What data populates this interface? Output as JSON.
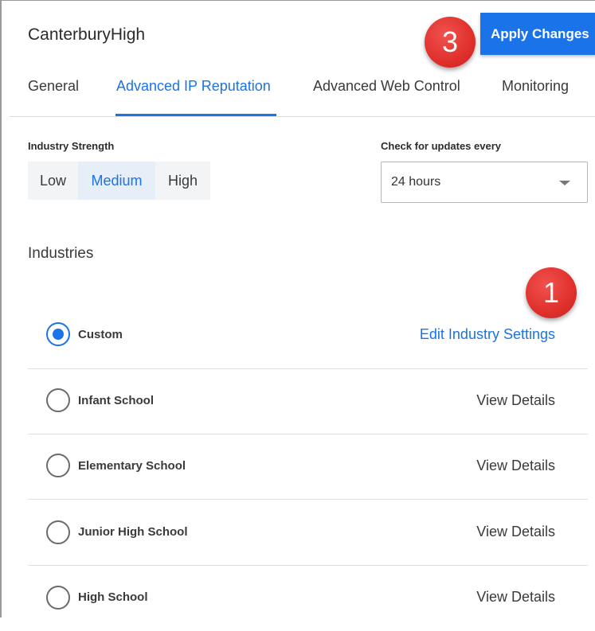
{
  "header": {
    "title": "CanterburyHigh",
    "apply_label": "Apply Changes"
  },
  "tabs": [
    {
      "label": "General",
      "active": false
    },
    {
      "label": "Advanced IP Reputation",
      "active": true
    },
    {
      "label": "Advanced Web Control",
      "active": false
    },
    {
      "label": "Monitoring",
      "active": false
    }
  ],
  "strength": {
    "label": "Industry Strength",
    "options": [
      "Low",
      "Medium",
      "High"
    ],
    "selected": "Medium"
  },
  "updates": {
    "label": "Check for updates every",
    "value": "24 hours"
  },
  "industries": {
    "heading": "Industries",
    "rows": [
      {
        "label": "Custom",
        "link": "Edit Industry Settings",
        "selected": true
      },
      {
        "label": "Infant School",
        "link": "View Details",
        "selected": false
      },
      {
        "label": "Elementary School",
        "link": "View Details",
        "selected": false
      },
      {
        "label": "Junior High School",
        "link": "View Details",
        "selected": false
      },
      {
        "label": "High School",
        "link": "View Details",
        "selected": false
      }
    ]
  },
  "callouts": {
    "apply": "3",
    "edit": "1"
  },
  "colors": {
    "accent": "#1a73e8",
    "callout": "#e0302c"
  }
}
